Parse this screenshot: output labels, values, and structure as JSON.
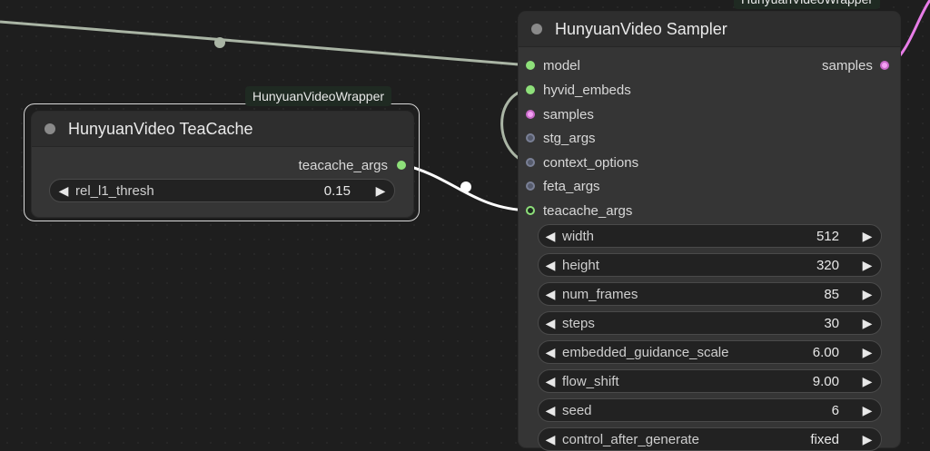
{
  "colors": {
    "canvas": "#1e1e1e",
    "node_body": "#353535",
    "slot_green": "#8ee07a",
    "slot_pink": "#f3a0f3",
    "slot_gray": "#7a8096",
    "wire_model": "#aab5a5",
    "wire_teacache": "#ffffff",
    "wire_samples": "#e87de8"
  },
  "groups": {
    "top_label": "HunyuanVideoWrapper",
    "tea_label": "HunyuanVideoWrapper"
  },
  "teacache_node": {
    "title": "HunyuanVideo TeaCache",
    "output": "teacache_args",
    "widget": {
      "label": "rel_l1_thresh",
      "value": "0.15"
    }
  },
  "sampler_node": {
    "title": "HunyuanVideo Sampler",
    "output": "samples",
    "inputs": [
      "model",
      "hyvid_embeds",
      "samples",
      "stg_args",
      "context_options",
      "feta_args",
      "teacache_args"
    ],
    "widgets": [
      {
        "label": "width",
        "value": "512"
      },
      {
        "label": "height",
        "value": "320"
      },
      {
        "label": "num_frames",
        "value": "85"
      },
      {
        "label": "steps",
        "value": "30"
      },
      {
        "label": "embedded_guidance_scale",
        "value": "6.00"
      },
      {
        "label": "flow_shift",
        "value": "9.00"
      },
      {
        "label": "seed",
        "value": "6"
      },
      {
        "label": "control_after_generate",
        "value": "fixed"
      }
    ]
  },
  "icons": {
    "left_arrow": "◀",
    "right_arrow": "▶"
  }
}
